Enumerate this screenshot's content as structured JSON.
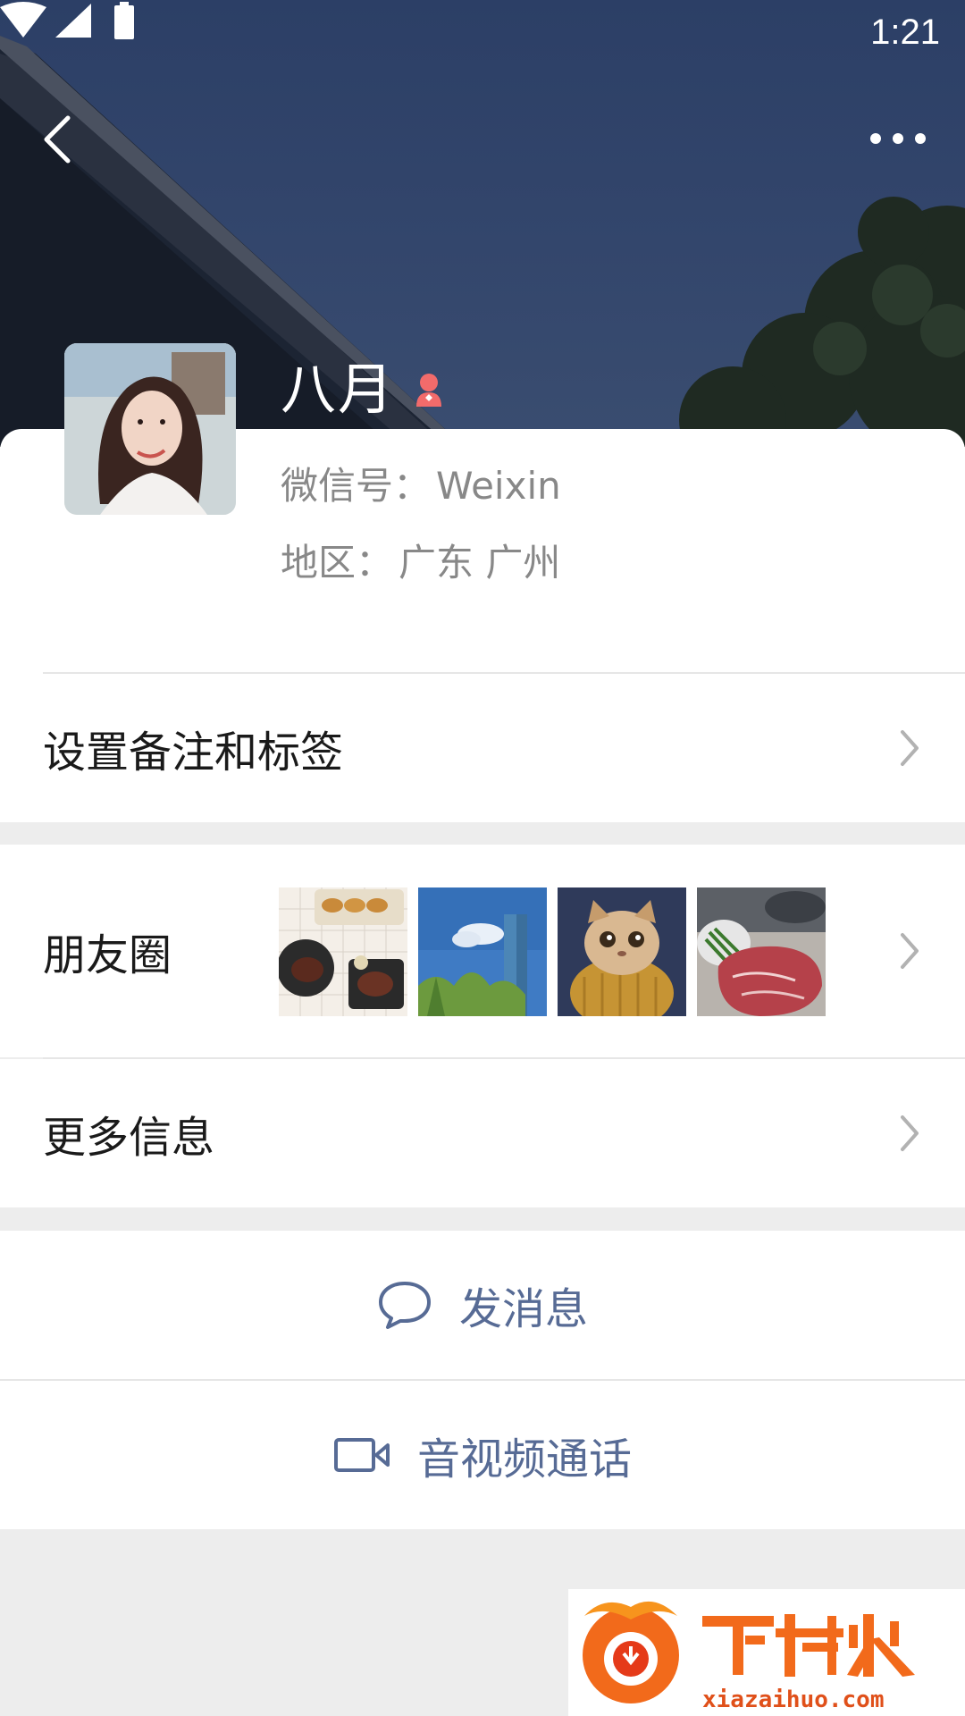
{
  "status_bar": {
    "time": "1:21"
  },
  "profile": {
    "name": "八月",
    "wechat_id_label": "微信号：",
    "wechat_id": "Weixin",
    "region_label": "地区：",
    "region": "广东 广州",
    "gender": "female"
  },
  "rows": {
    "remark_label": "设置备注和标签",
    "moments_label": "朋友圈",
    "more_info_label": "更多信息"
  },
  "actions": {
    "send_message": "发消息",
    "video_call": "音视频通话"
  },
  "icons": {
    "back": "back-arrow-icon",
    "more": "more-dots-icon",
    "gender": "female-icon",
    "chat": "chat-bubble-icon",
    "video": "video-camera-icon",
    "chevron": "chevron-right-icon"
  },
  "colors": {
    "link_blue": "#576b95",
    "female_pink": "#f26b6b",
    "background": "#ededed"
  },
  "watermark": {
    "brand": "下载火",
    "site": "xiazaihuo.com"
  }
}
